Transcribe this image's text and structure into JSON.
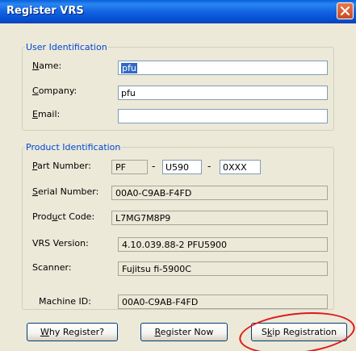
{
  "window": {
    "title": "Register VRS"
  },
  "user_identification": {
    "legend": "User Identification",
    "name": {
      "label_mn": "N",
      "label_rest": "ame:",
      "value": "pfu"
    },
    "company": {
      "label_mn": "C",
      "label_rest": "ompany:",
      "value": "pfu"
    },
    "email": {
      "label_mn": "E",
      "label_rest": "mail:",
      "value": ""
    }
  },
  "product_identification": {
    "legend": "Product Identification",
    "part_number": {
      "label_mn": "P",
      "label_rest": "art Number:",
      "part1": "PF",
      "sep": "-",
      "part2": "U590",
      "part3": "0XXX"
    },
    "serial_number": {
      "label_mn": "S",
      "label_rest": "erial Number:",
      "value": "00A0-C9AB-F4FD"
    },
    "product_code": {
      "label_pre": "Prod",
      "label_mn": "u",
      "label_rest": "ct Code:",
      "value": "L7MG7M8P9"
    },
    "vrs_version": {
      "label": "VRS Version:",
      "value": "4.10.039.88-2 PFU5900"
    },
    "scanner": {
      "label": "Scanner:",
      "value": "Fujitsu fi-5900C"
    }
  },
  "machine_id": {
    "label": "Machine ID:",
    "value": "00A0-C9AB-F4FD"
  },
  "buttons": {
    "why": {
      "mn": "W",
      "rest": "hy Register?"
    },
    "register": {
      "mn": "R",
      "rest": "egister Now"
    },
    "skip": {
      "pre": "S",
      "mn": "k",
      "rest": "ip Registration"
    }
  },
  "colors": {
    "annotation_circle": "#e01818",
    "legend_text": "#0046d5",
    "title_bar": "#0a5fd8"
  }
}
